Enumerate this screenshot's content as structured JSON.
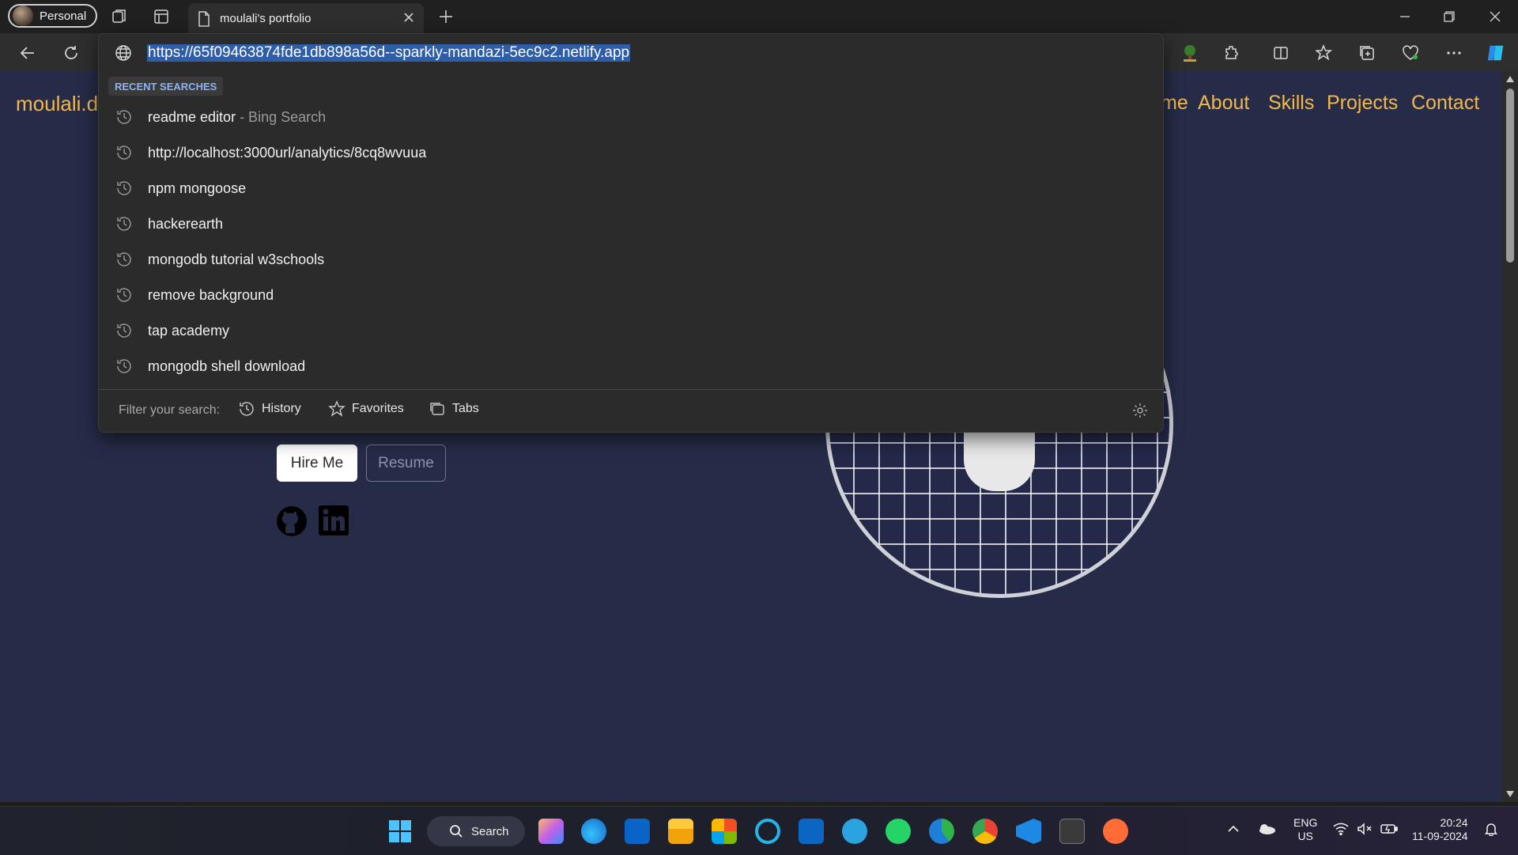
{
  "browser": {
    "profile_label": "Personal",
    "tab_title": "moulali's portfolio",
    "address_url": "https://65f09463874fde1db898a56d--sparkly-mandazi-5ec9c2.netlify.app"
  },
  "dropdown": {
    "section_label": "RECENT SEARCHES",
    "suggestions": [
      {
        "text": "readme editor",
        "suffix": " - Bing Search"
      },
      {
        "text": "http://localhost:3000url/analytics/8cq8wvuua",
        "suffix": ""
      },
      {
        "text": "npm mongoose",
        "suffix": ""
      },
      {
        "text": "hackerearth",
        "suffix": ""
      },
      {
        "text": "mongodb tutorial w3schools",
        "suffix": ""
      },
      {
        "text": "remove background",
        "suffix": ""
      },
      {
        "text": "tap academy",
        "suffix": ""
      },
      {
        "text": "mongodb shell download",
        "suffix": ""
      }
    ],
    "filter_label": "Filter your search:",
    "filters": [
      "History",
      "Favorites",
      "Tabs"
    ]
  },
  "page": {
    "brand": "moulali.d",
    "nav": [
      "me",
      "About",
      "Skills",
      "Projects",
      "Contact"
    ],
    "hire_label": "Hire Me",
    "resume_label": "Resume"
  },
  "taskbar": {
    "search_label": "Search",
    "lang_top": "ENG",
    "lang_bottom": "US",
    "time": "20:24",
    "date": "11-09-2024"
  },
  "colors": {
    "page_bg": "#262c48",
    "accent_nav": "#f2b84b",
    "url_selection": "#2e5ea8",
    "section_label": "#8ab4f8"
  }
}
